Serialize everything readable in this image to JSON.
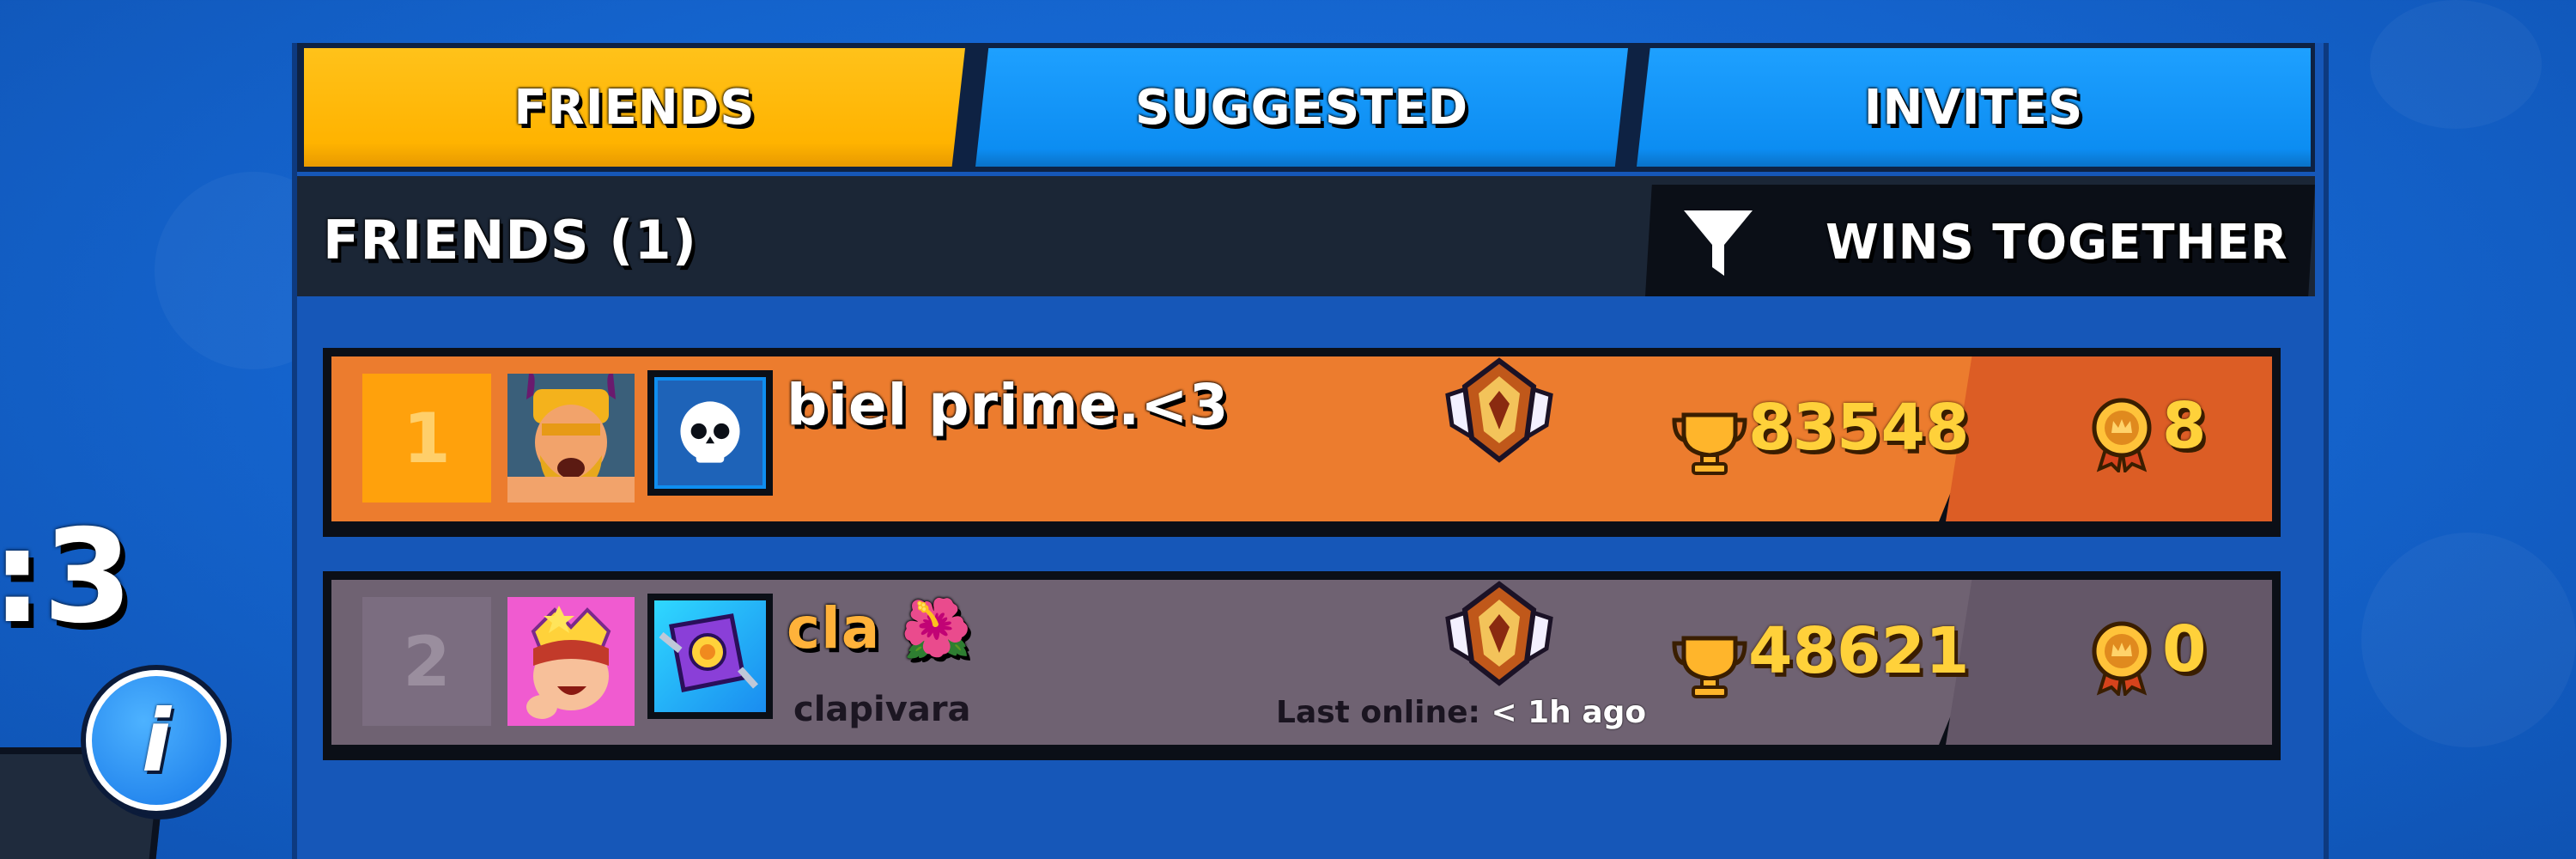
{
  "tabs": {
    "friends": "FRIENDS",
    "suggested": "SUGGESTED",
    "invites": "INVITES",
    "active": "FRIENDS"
  },
  "header": {
    "friends_count_label": "FRIENDS (1)",
    "sort_label": "WINS TOGETHER"
  },
  "left_edge": {
    "partial_text": ":3",
    "info_icon_glyph": "i"
  },
  "friends": [
    {
      "rank": "1",
      "name": "biel prime.<3",
      "tag": "",
      "last_online": "",
      "trophies": "83548",
      "wins_together": "8",
      "avatar_icon": "barbarian-king-avatar-icon",
      "club_icon": "skull-club-badge-icon",
      "rank_icon": "masters-rank-emblem-icon",
      "row_color": "#ec7c2e"
    },
    {
      "rank": "2",
      "name": "cla 🌺",
      "tag": "clapivara",
      "last_online_label": "Last online:",
      "last_online_value": "< 1h ago",
      "trophies": "48621",
      "wins_together": "0",
      "avatar_icon": "princess-avatar-icon",
      "club_icon": "purple-book-club-badge-icon",
      "rank_icon": "masters-rank-emblem-icon",
      "row_color": "#6f6272"
    }
  ],
  "colors": {
    "tab_active": "#ffb300",
    "tab_inactive": "#0c8df2",
    "trophy_text": "#ffd13a",
    "background": "#1463cc"
  }
}
